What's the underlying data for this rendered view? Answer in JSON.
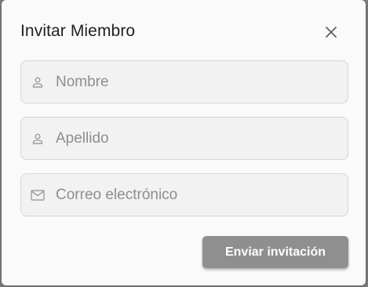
{
  "dialog": {
    "title": "Invitar Miembro",
    "close_icon": "close-icon"
  },
  "form": {
    "first_name": {
      "placeholder": "Nombre",
      "value": "",
      "icon": "person-icon"
    },
    "last_name": {
      "placeholder": "Apellido",
      "value": "",
      "icon": "person-icon"
    },
    "email": {
      "placeholder": "Correo electrónico",
      "value": "",
      "icon": "mail-icon"
    }
  },
  "actions": {
    "send_label": "Enviar invitación"
  },
  "colors": {
    "button_disabled": "#8f8f8f",
    "dialog_bg": "#fafafa",
    "field_bg": "#f2f2f2",
    "icon": "#9e9e9e"
  }
}
